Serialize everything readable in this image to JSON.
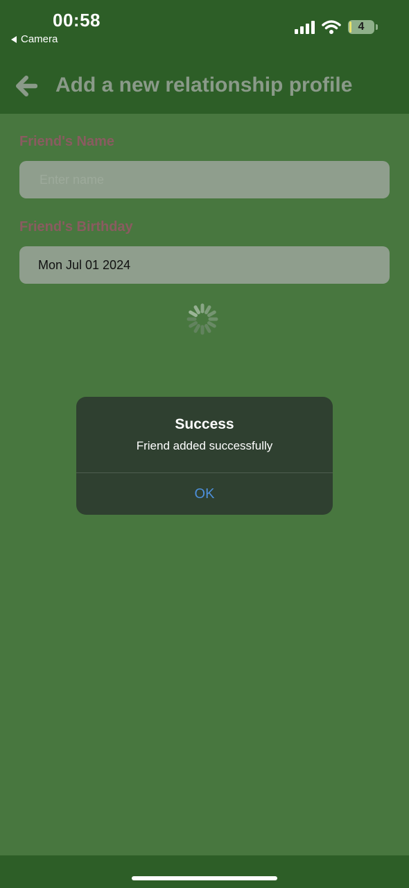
{
  "status_bar": {
    "time": "00:58",
    "back_app_label": "Camera",
    "battery_level": "4"
  },
  "header": {
    "title": "Add a new relationship profile"
  },
  "form": {
    "name_label": "Friend's Name",
    "name_placeholder": "Enter name",
    "name_value": "",
    "birthday_label": "Friend's Birthday",
    "birthday_value": "Mon Jul 01 2024"
  },
  "alert": {
    "title": "Success",
    "message": "Friend added successfully",
    "ok_label": "OK"
  },
  "colors": {
    "background": "#48773f",
    "header_background": "#2d5e27",
    "label_color": "#8a5b60",
    "alert_background": "#2f4030",
    "alert_button": "#4d8fd9"
  }
}
